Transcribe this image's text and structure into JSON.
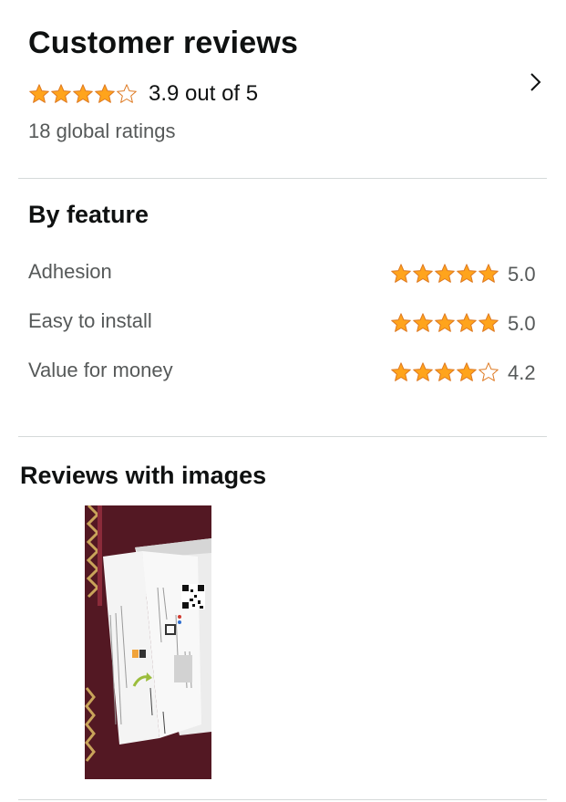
{
  "customer_reviews": {
    "title": "Customer reviews",
    "overall_rating": 3.9,
    "overall_text": "3.9 out of 5",
    "global_ratings": "18 global ratings",
    "chevron_icon": "chevron-right-icon"
  },
  "by_feature": {
    "title": "By feature",
    "features": [
      {
        "label": "Adhesion",
        "rating": 5.0,
        "value": "5.0"
      },
      {
        "label": "Easy to install",
        "rating": 5.0,
        "value": "5.0"
      },
      {
        "label": "Value for money",
        "rating": 4.2,
        "value": "4.2"
      }
    ]
  },
  "reviews_with_images": {
    "title": "Reviews with images",
    "images": [
      {
        "description": "review-photo"
      }
    ]
  },
  "colors": {
    "star_fill": "#ffa41c",
    "star_stroke": "#de7921",
    "text_primary": "#0f1111",
    "text_secondary": "#565959",
    "divider": "#d5d9d9"
  }
}
